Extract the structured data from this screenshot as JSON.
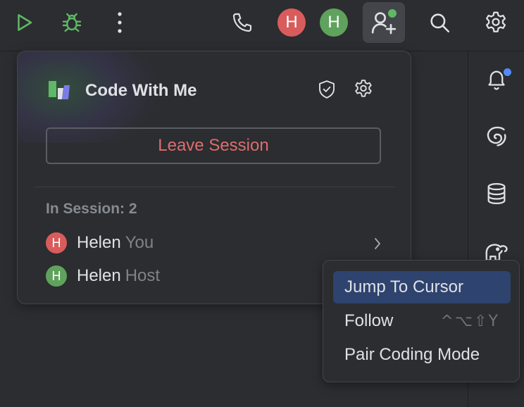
{
  "toolbar": {
    "user_avatars": [
      {
        "initial": "H",
        "color": "#d95c5c"
      },
      {
        "initial": "H",
        "color": "#5fa25d"
      }
    ]
  },
  "popup": {
    "title": "Code With Me",
    "leave_label": "Leave Session",
    "in_session_label": "In Session: 2",
    "members": [
      {
        "initial": "H",
        "name": "Helen",
        "role": "You",
        "color": "#d95c5c"
      },
      {
        "initial": "H",
        "name": "Helen",
        "role": "Host",
        "color": "#5fa25d"
      }
    ]
  },
  "context_menu": {
    "items": [
      {
        "label": "Jump To Cursor",
        "shortcut": ""
      },
      {
        "label": "Follow",
        "shortcut": "^⌥⇧Y"
      },
      {
        "label": "Pair Coding Mode",
        "shortcut": ""
      }
    ]
  },
  "colors": {
    "background": "#2b2d30",
    "danger": "#e06c6c",
    "selection": "#2e436e",
    "run_green": "#5fb865"
  }
}
